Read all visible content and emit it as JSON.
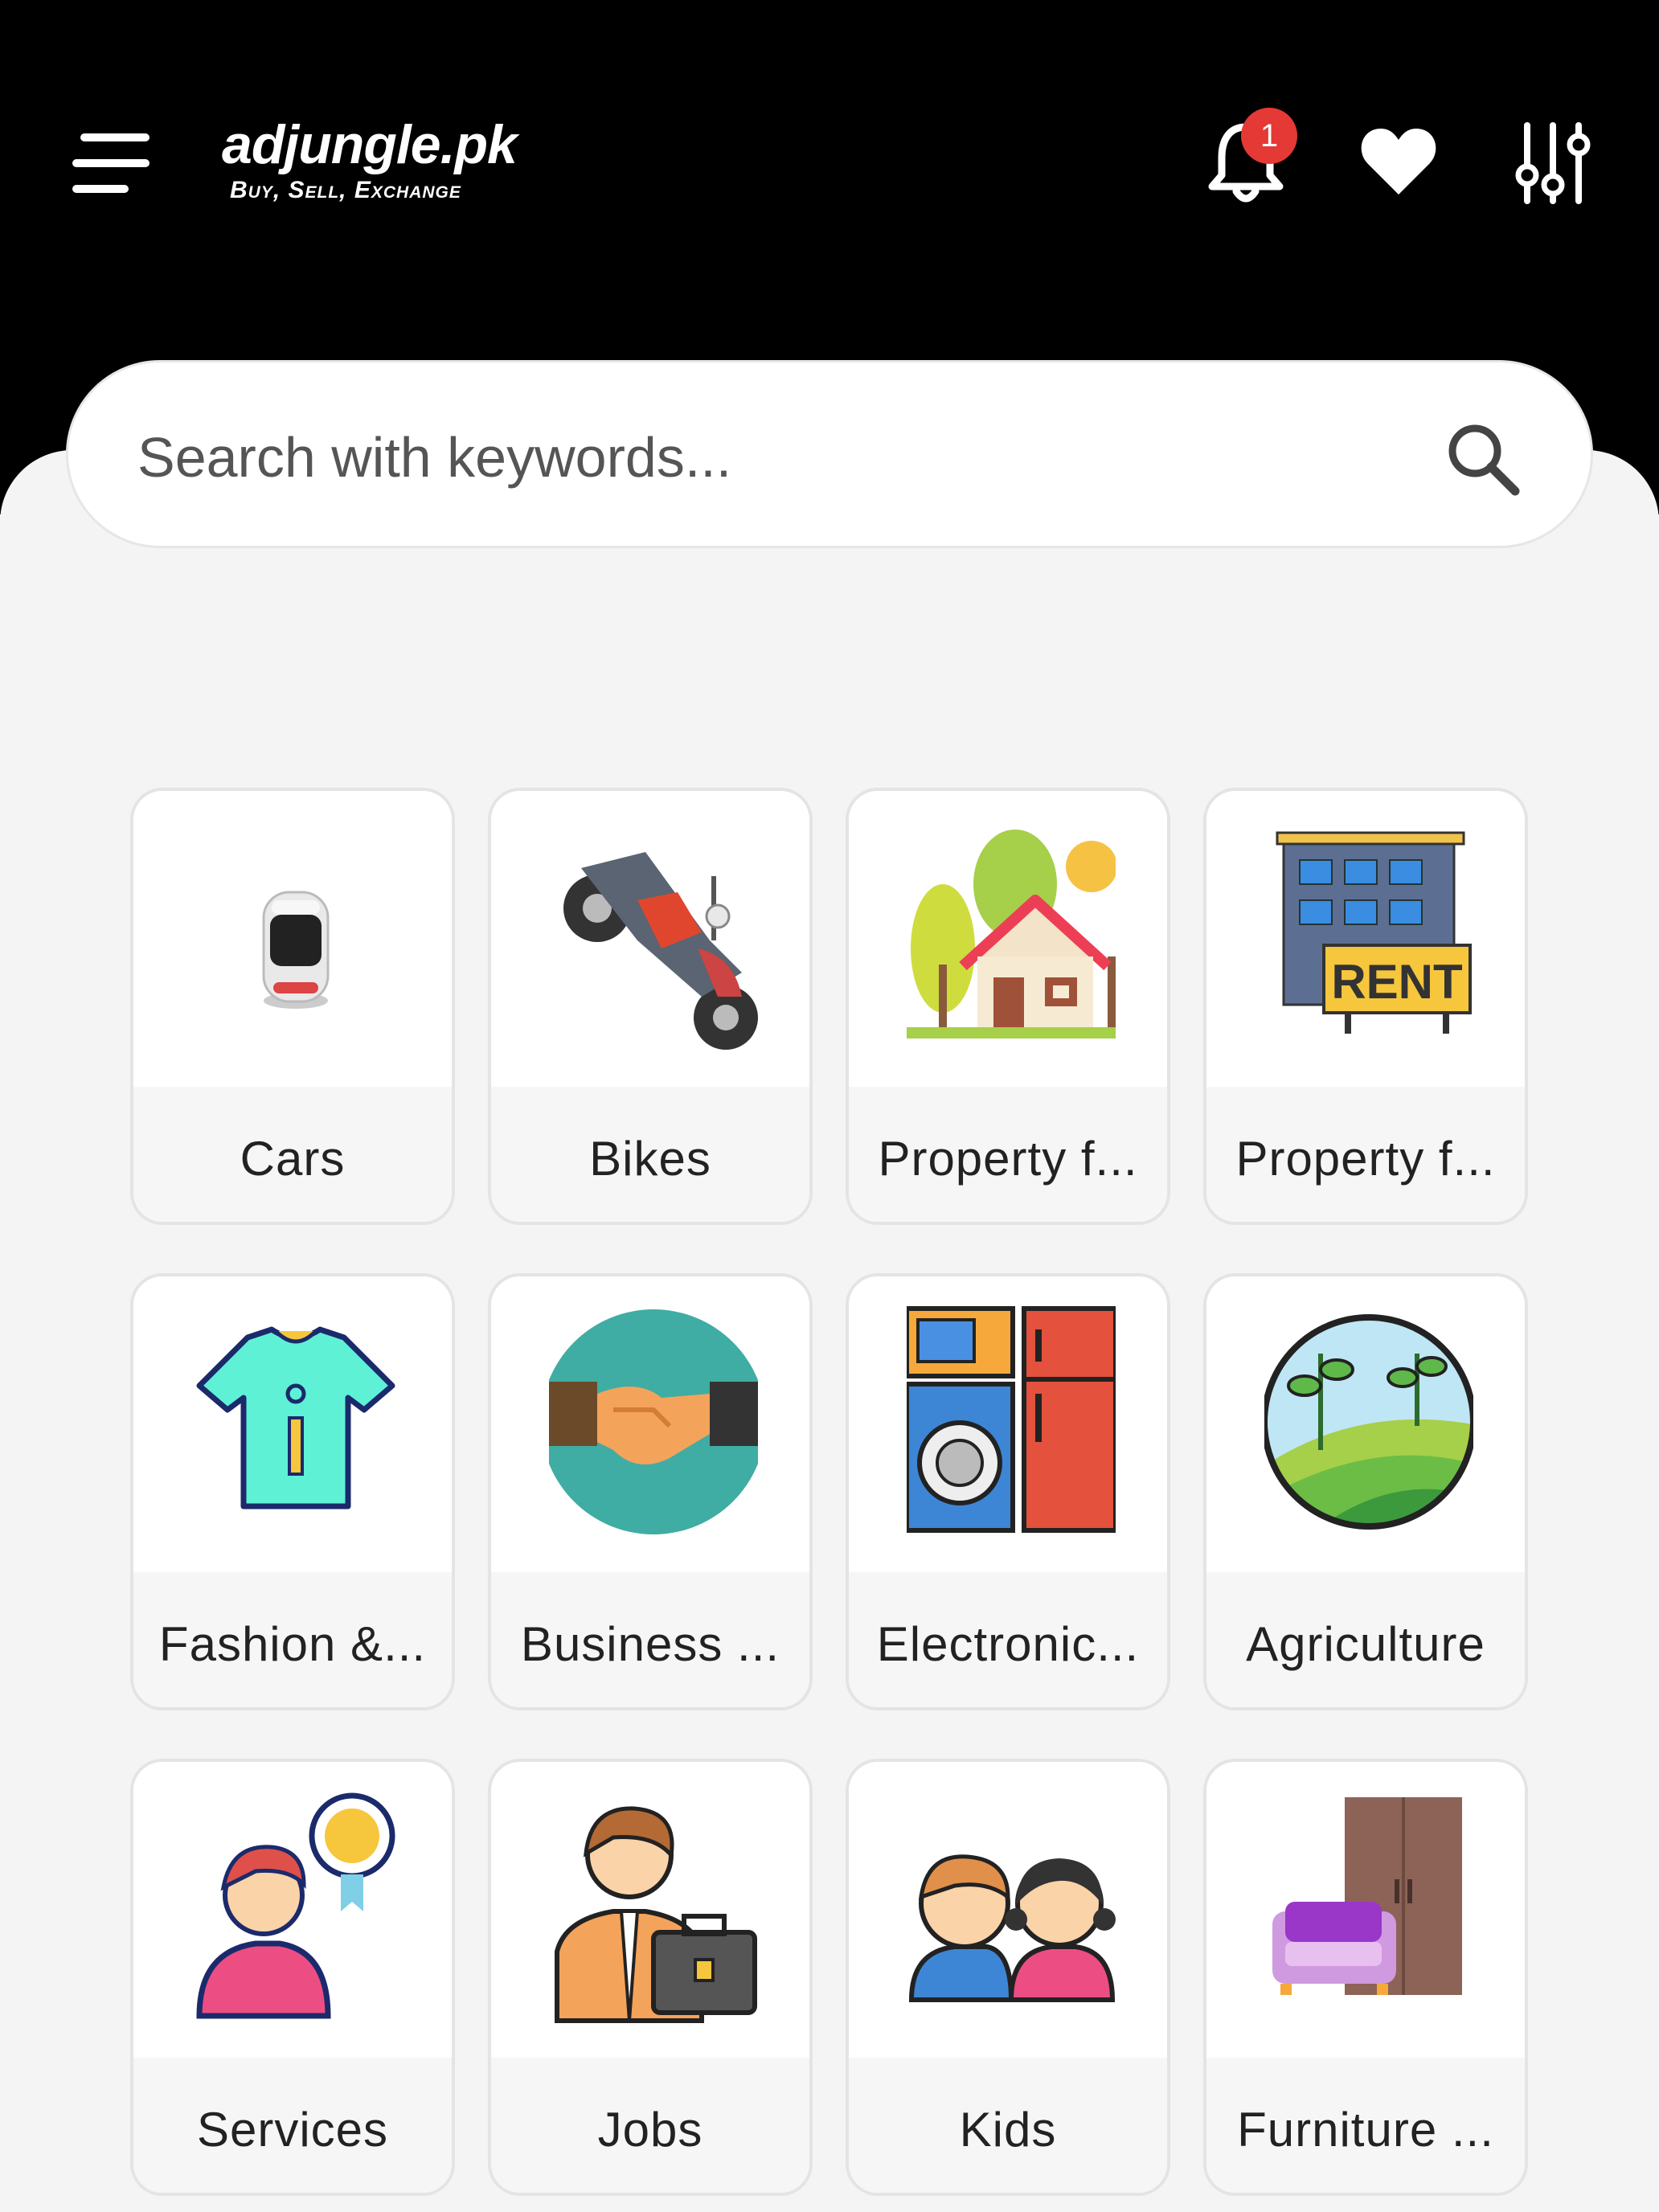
{
  "header": {
    "brand": "adjungle.pk",
    "tagline": "Buy, Sell, Exchange",
    "notification_count": "1",
    "icons": [
      "menu-icon",
      "bell-icon",
      "heart-icon",
      "sliders-icon"
    ]
  },
  "search": {
    "placeholder": "Search with keywords...",
    "icon": "search-icon"
  },
  "categories": [
    {
      "label": "Cars",
      "icon": "car-icon"
    },
    {
      "label": "Bikes",
      "icon": "motorbike-icon"
    },
    {
      "label": "Property f...",
      "icon": "house-icon"
    },
    {
      "label": "Property f...",
      "icon": "rent-building-icon"
    },
    {
      "label": "Fashion &...",
      "icon": "tshirt-icon"
    },
    {
      "label": "Business ...",
      "icon": "handshake-icon"
    },
    {
      "label": "Electronic...",
      "icon": "appliances-icon"
    },
    {
      "label": "Agriculture",
      "icon": "farm-icon"
    },
    {
      "label": "Services",
      "icon": "service-person-icon"
    },
    {
      "label": "Jobs",
      "icon": "businessman-briefcase-icon"
    },
    {
      "label": "Kids",
      "icon": "kids-icon"
    },
    {
      "label": "Furniture ...",
      "icon": "furniture-icon"
    }
  ],
  "colors": {
    "header_bg": "#000000",
    "page_bg": "#f4f4f4",
    "badge": "#e53935"
  }
}
